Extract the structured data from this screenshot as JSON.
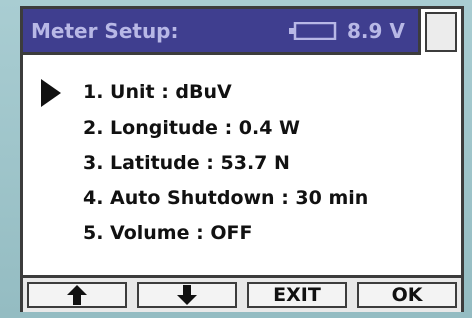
{
  "header": {
    "title": "Meter Setup:",
    "voltage": "8.9 V",
    "battery_icon": "battery-icon"
  },
  "menu": {
    "selected_index": 0,
    "items": [
      {
        "label": "1. Unit : dBuV"
      },
      {
        "label": "2. Longitude : 0.4 W"
      },
      {
        "label": "3. Latitude :  53.7 N"
      },
      {
        "label": "4. Auto Shutdown : 30 min"
      },
      {
        "label": "5. Volume : OFF"
      }
    ]
  },
  "softkeys": {
    "up_icon": "arrow-up-icon",
    "down_icon": "arrow-down-icon",
    "exit_label": "EXIT",
    "ok_label": "OK"
  },
  "colors": {
    "titlebar": "#3f3e8f",
    "title_text": "#b8b8e6",
    "background": "#9fc4c9"
  }
}
